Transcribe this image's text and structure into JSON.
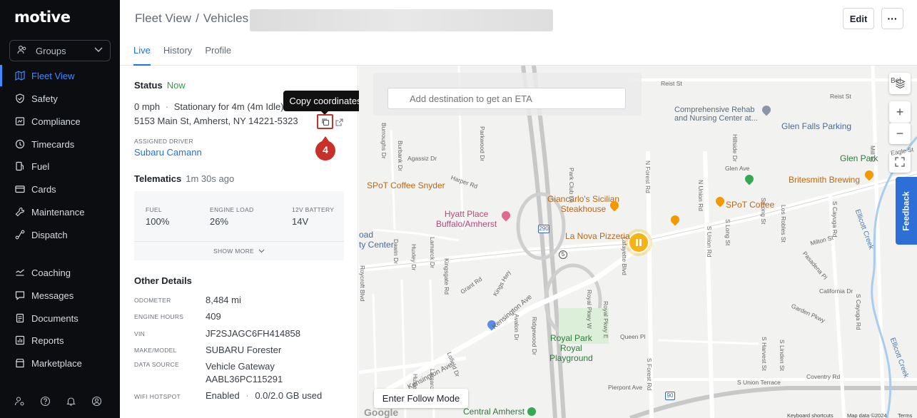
{
  "sidebar": {
    "logo": "motive",
    "groups_label": "Groups",
    "items": [
      {
        "label": "Fleet View",
        "icon": "map-icon"
      },
      {
        "label": "Safety",
        "icon": "shield-icon"
      },
      {
        "label": "Compliance",
        "icon": "compliance-icon"
      },
      {
        "label": "Timecards",
        "icon": "clock-icon"
      },
      {
        "label": "Fuel",
        "icon": "fuel-icon"
      },
      {
        "label": "Cards",
        "icon": "card-icon"
      },
      {
        "label": "Maintenance",
        "icon": "wrench-icon"
      },
      {
        "label": "Dispatch",
        "icon": "dispatch-icon"
      },
      {
        "label": "Coaching",
        "icon": "coaching-icon"
      },
      {
        "label": "Messages",
        "icon": "message-icon"
      },
      {
        "label": "Documents",
        "icon": "document-icon"
      },
      {
        "label": "Reports",
        "icon": "report-icon"
      },
      {
        "label": "Marketplace",
        "icon": "marketplace-icon"
      }
    ]
  },
  "header": {
    "breadcrumb_1": "Fleet View",
    "breadcrumb_sep": "/",
    "breadcrumb_2": "Vehicles",
    "tabs": [
      "Live",
      "History",
      "Profile"
    ],
    "edit_label": "Edit",
    "more_label": "···"
  },
  "status": {
    "title": "Status",
    "time": "Now",
    "speed": "0 mph",
    "separator": "·",
    "state": "Stationary for 4m (4m Idle)",
    "address": "5153 Main St, Amherst, NY 14221-5323",
    "tooltip": "Copy coordinates",
    "step_number": "4",
    "assigned_driver_label": "ASSIGNED DRIVER",
    "driver": "Subaru Camann"
  },
  "telematics": {
    "title": "Telematics",
    "time": "1m 30s ago",
    "fuel_label": "FUEL",
    "fuel_value": "100%",
    "engine_load_label": "ENGINE LOAD",
    "engine_load_value": "26%",
    "battery_label": "12V BATTERY",
    "battery_value": "14V",
    "show_more": "SHOW MORE"
  },
  "other": {
    "title": "Other Details",
    "odometer_label": "ODOMETER",
    "odometer_value": "8,484 mi",
    "engine_hours_label": "ENGINE HOURS",
    "engine_hours_value": "409",
    "vin_label": "VIN",
    "vin_value": "JF2SJAGC6FH414858",
    "make_label": "MAKE/MODEL",
    "make_value": "SUBARU Forester",
    "source_label": "DATA SOURCE",
    "source_value_1": "Vehicle Gateway",
    "source_value_2": "AABL36PC115291",
    "wifi_label": "WIFI HOTSPOT",
    "wifi_value": "Enabled",
    "wifi_sep": "·",
    "wifi_usage": "0.0/2.0 GB used"
  },
  "map": {
    "search_placeholder": "Add destination to get an ETA",
    "follow_mode": "Enter Follow Mode",
    "feedback": "Feedback",
    "zoom_in": "+",
    "zoom_out": "−",
    "google": "Google",
    "footer_shortcuts": "Keyboard shortcuts",
    "footer_data": "Map data ©2024",
    "footer_terms": "Terms",
    "places": {
      "comprehensive_1": "Comprehensive Rehab",
      "comprehensive_2": "and Nursing Center at...",
      "glen_falls": "Glen Falls Parking",
      "glen_park": "Glen Park",
      "britesmith": "Britesmith Brewing",
      "spot_snyder": "SPoT Coffee Snyder",
      "spot_coffee": "SPoT Coffee",
      "hyatt_1": "Hyatt Place",
      "hyatt_2": "Buffalo/Amherst",
      "giancarlo_1": "Giancarlo's Sicilian",
      "giancarlo_2": "Steakhouse",
      "la_nova": "La Nova Pizzeria",
      "royal_1": "Royal Park",
      "royal_2": "Royal",
      "royal_3": "Playground",
      "central_amherst": "Central Amherst",
      "ellicott_creek": "Ellicott Creek",
      "ellicott_creek_2": "Ellicott Creek",
      "city_center_1": "oad",
      "city_center_2": "ty Center",
      "bel": "Bel"
    },
    "streets": {
      "reist_1": "Reist St",
      "reist_2": "Reist St",
      "agassiz": "Agassiz Dr",
      "harper": "Harper Rd",
      "park_club": "Park Club Ln",
      "n_forest": "N Forest Rd",
      "s_forest": "S Forest Rd",
      "n_union": "N Union Rd",
      "s_union": "S Union Rd",
      "kensington_1": "Kensington Ave",
      "kensington_2": "Kensington Ave",
      "kings_hwy": "Kings Hwy",
      "grant": "Grant Rd",
      "avalon": "Avalon Dr",
      "ridgewood": "Ridgewood Dr",
      "queen": "Queen Pl",
      "pierpont": "Pierpont Ave",
      "s_union_terrace": "S Union Terrace",
      "coventry": "Coventry Rd",
      "california": "California Dr",
      "milton": "Milton St",
      "garden": "Garden Pkwy",
      "glen_ave": "Glen Ave",
      "eagle": "Eagle St",
      "s_cayuga": "S Cayuga Rd",
      "burroughs": "Burroughs Dr",
      "burbank": "Burbank Dr",
      "parkwood": "Parkwood Dr",
      "dawin": "Dawin Dr",
      "huxley": "Huxley Dr",
      "lamarck": "Lamarck Dr",
      "kingsgate": "Kingsgate Rd",
      "roycroft": "Roycroft Blvd",
      "lafayette": "Lafayette Blvd",
      "royal_pkwy_w": "Royal Pkwy W",
      "royal_pkwy_e": "Royal Pkwy E",
      "loffield": "Lofield Dr",
      "pasadena": "Pasadena Pl",
      "los_robles": "Los Robles St",
      "s_long": "S Long St",
      "s_harvest": "S Harvest St",
      "s_linden": "S Linden St",
      "hillside": "Hillside Dr",
      "mill": "Mill St",
      "route_290": "290",
      "route_5": "5",
      "route_90": "90"
    }
  }
}
